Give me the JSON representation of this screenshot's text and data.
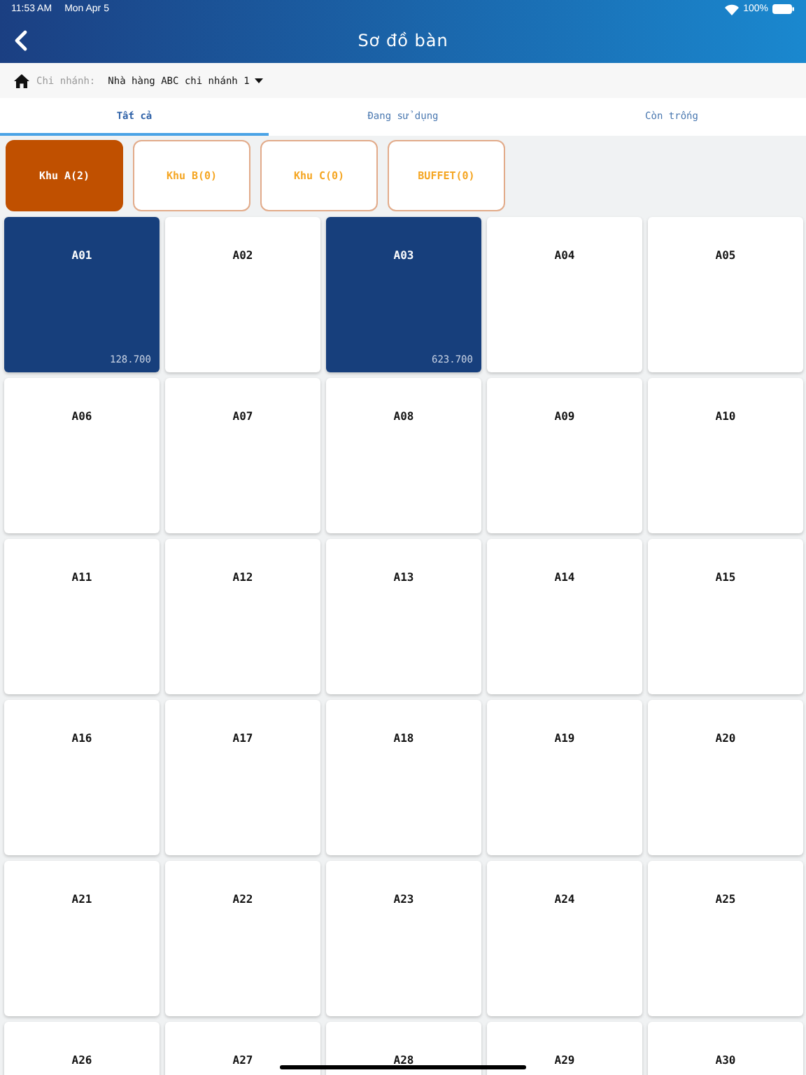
{
  "status_bar": {
    "time": "11:53 AM",
    "date": "Mon Apr 5",
    "battery": "100%"
  },
  "header": {
    "title": "Sơ đồ bàn"
  },
  "branch": {
    "label": "Chi nhánh:",
    "value": "Nhà hàng ABC chi nhánh 1"
  },
  "tabs": [
    {
      "label": "Tất cả",
      "selected": true
    },
    {
      "label": "Đang sử dụng",
      "selected": false
    },
    {
      "label": "Còn trống",
      "selected": false
    }
  ],
  "zones": [
    {
      "label": "Khu A(2)",
      "selected": true
    },
    {
      "label": "Khu B(0)",
      "selected": false
    },
    {
      "label": "Khu C(0)",
      "selected": false
    },
    {
      "label": "BUFFET(0)",
      "selected": false
    }
  ],
  "tables": [
    {
      "name": "A01",
      "occupied": true,
      "amount": "128.700"
    },
    {
      "name": "A02",
      "occupied": false
    },
    {
      "name": "A03",
      "occupied": true,
      "amount": "623.700"
    },
    {
      "name": "A04",
      "occupied": false
    },
    {
      "name": "A05",
      "occupied": false
    },
    {
      "name": "A06",
      "occupied": false
    },
    {
      "name": "A07",
      "occupied": false
    },
    {
      "name": "A08",
      "occupied": false
    },
    {
      "name": "A09",
      "occupied": false
    },
    {
      "name": "A10",
      "occupied": false
    },
    {
      "name": "A11",
      "occupied": false
    },
    {
      "name": "A12",
      "occupied": false
    },
    {
      "name": "A13",
      "occupied": false
    },
    {
      "name": "A14",
      "occupied": false
    },
    {
      "name": "A15",
      "occupied": false
    },
    {
      "name": "A16",
      "occupied": false
    },
    {
      "name": "A17",
      "occupied": false
    },
    {
      "name": "A18",
      "occupied": false
    },
    {
      "name": "A19",
      "occupied": false
    },
    {
      "name": "A20",
      "occupied": false
    },
    {
      "name": "A21",
      "occupied": false
    },
    {
      "name": "A22",
      "occupied": false
    },
    {
      "name": "A23",
      "occupied": false
    },
    {
      "name": "A24",
      "occupied": false
    },
    {
      "name": "A25",
      "occupied": false
    },
    {
      "name": "A26",
      "occupied": false
    },
    {
      "name": "A27",
      "occupied": false
    },
    {
      "name": "A28",
      "occupied": false
    },
    {
      "name": "A29",
      "occupied": false
    },
    {
      "name": "A30",
      "occupied": false
    }
  ]
}
